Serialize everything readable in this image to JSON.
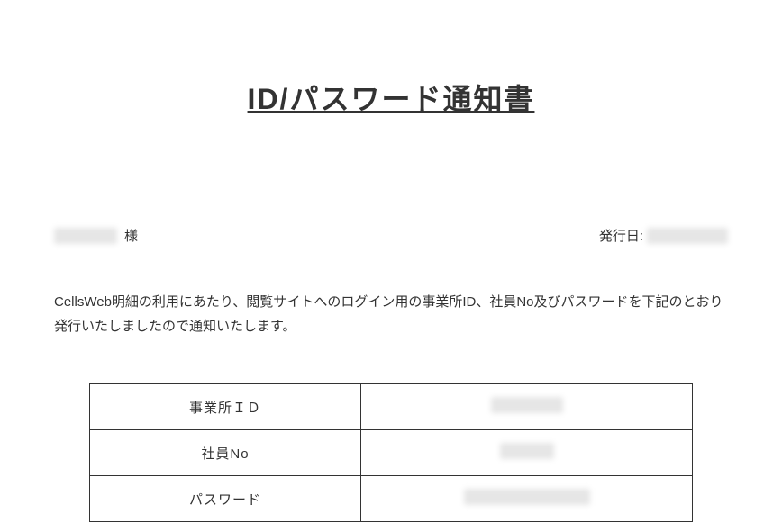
{
  "document": {
    "title": "ID/パスワード通知書",
    "recipient_name": "",
    "recipient_suffix": "様",
    "issue_date_label": "発行日:",
    "issue_date_value": "",
    "body": "CellsWeb明細の利用にあたり、閲覧サイトへのログイン用の事業所ID、社員No及びパスワードを下記のとおり発行いたしましたので通知いたします。",
    "credentials": [
      {
        "label": "事業所ＩＤ",
        "value": ""
      },
      {
        "label": "社員No",
        "value": ""
      },
      {
        "label": "パスワード",
        "value": ""
      }
    ]
  }
}
